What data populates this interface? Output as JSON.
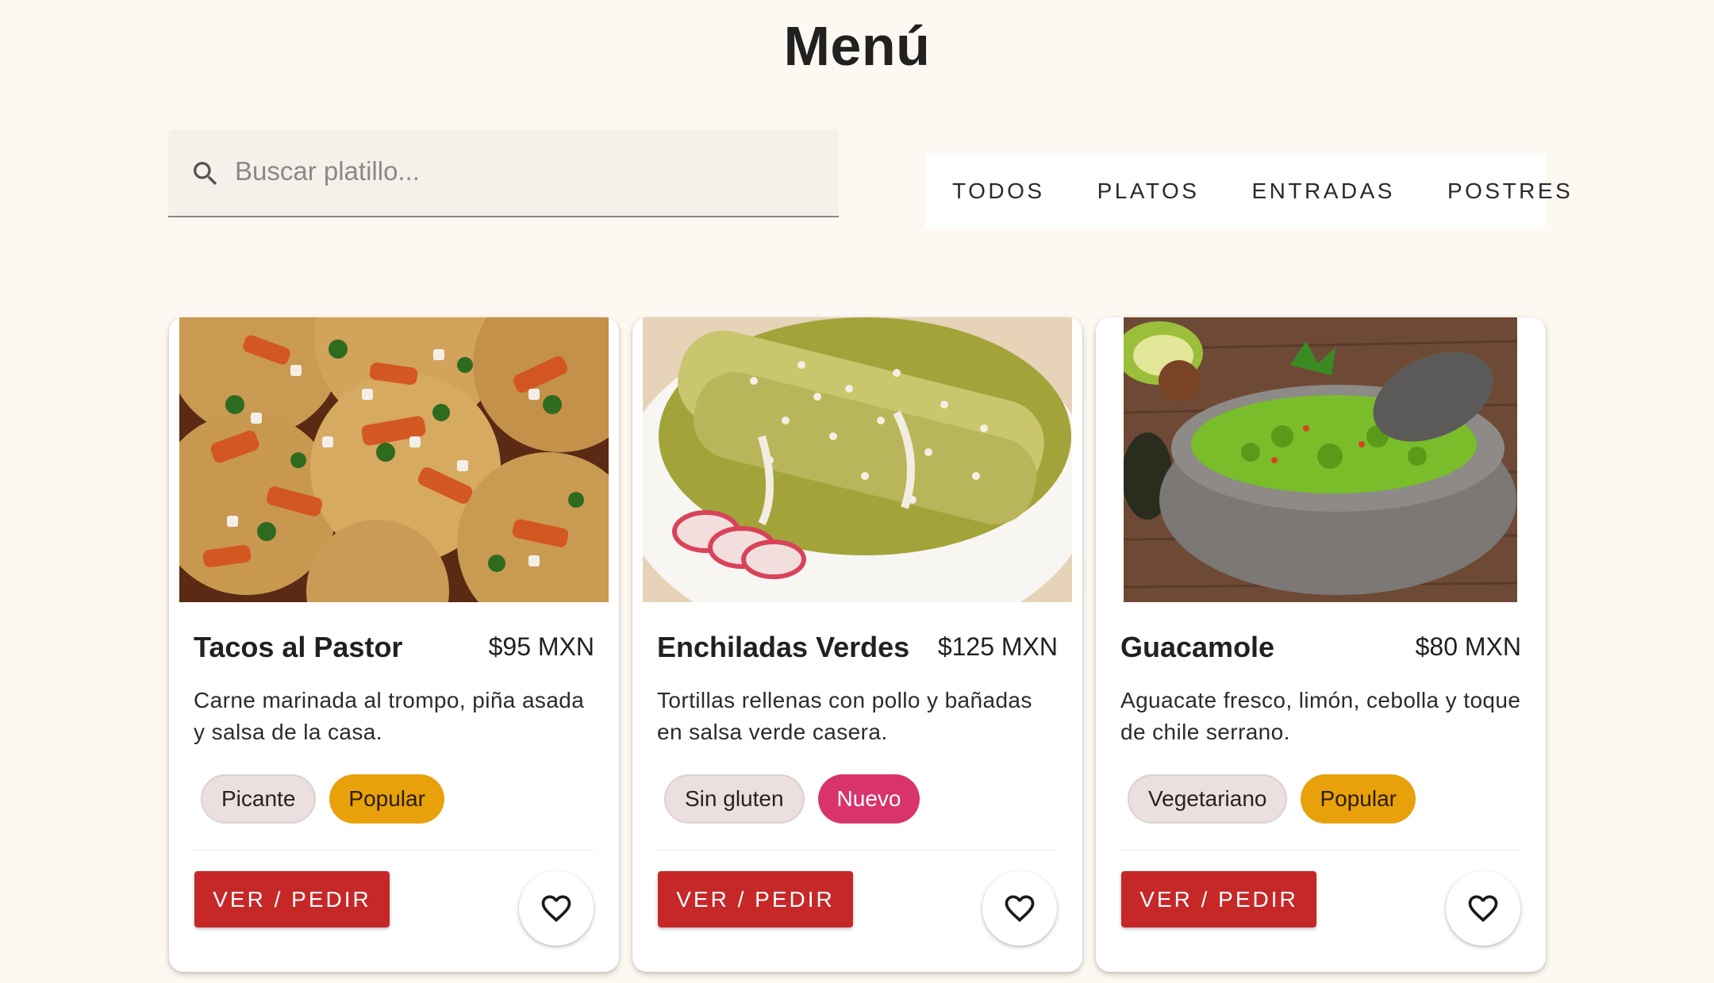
{
  "header": {
    "title": "Menú"
  },
  "search": {
    "placeholder": "Buscar platillo..."
  },
  "tabs": [
    {
      "label": "TODOS"
    },
    {
      "label": "PLATOS"
    },
    {
      "label": "ENTRADAS"
    },
    {
      "label": "POSTRES"
    }
  ],
  "cards": [
    {
      "name": "Tacos al Pastor",
      "price": "$95 MXN",
      "description": "Carne marinada al trompo, piña asada y salsa de la casa.",
      "tags": [
        {
          "label": "Picante"
        },
        {
          "label": "Popular"
        }
      ],
      "order_label": "VER / PEDIR"
    },
    {
      "name": "Enchiladas Verdes",
      "price": "$125 MXN",
      "description": "Tortillas rellenas con pollo y bañadas en salsa verde casera.",
      "tags": [
        {
          "label": "Sin gluten"
        },
        {
          "label": "Nuevo"
        }
      ],
      "order_label": "VER / PEDIR"
    },
    {
      "name": "Guacamole",
      "price": "$80 MXN",
      "description": "Aguacate fresco, limón, cebolla y toque de chile serrano.",
      "tags": [
        {
          "label": "Vegetariano"
        },
        {
          "label": "Popular"
        }
      ],
      "order_label": "VER / PEDIR"
    }
  ],
  "colors": {
    "background": "#fdf8f2",
    "accent_red": "#c62828",
    "popular_chip": "#e8a10b",
    "new_chip": "#d8336b",
    "neutral_chip": "#ebdfe0"
  },
  "icons": {
    "search": "search-icon",
    "favorite": "heart-outline-icon"
  }
}
